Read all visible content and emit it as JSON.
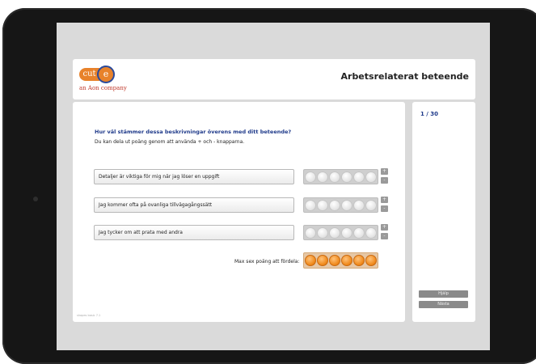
{
  "header": {
    "logo_cut": "cut",
    "logo_e": "e",
    "logo_subtitle": "an Aon company",
    "title": "Arbetsrelaterat beteende"
  },
  "question": {
    "prompt": "Hur väl stämmer dessa beskrivningar överens med ditt beteende?",
    "instruction": "Du kan dela ut poäng genom att använda + och - knapparna."
  },
  "statements": [
    {
      "label": "Detaljer är viktiga för mig när jag löser en uppgift",
      "points": 0
    },
    {
      "label": "Jag kommer ofta på ovanliga tillvägagångssätt",
      "points": 0
    },
    {
      "label": "Jag tycker om att prata med andra",
      "points": 0
    }
  ],
  "stepper": {
    "plus": "+",
    "minus": "-"
  },
  "max_points": {
    "label": "Max sex poäng att fördela:",
    "remaining": 6
  },
  "progress": "1 / 30",
  "nav": {
    "help": "Hjälp",
    "next": "Nästa"
  },
  "version": "shapes basic 7.1"
}
